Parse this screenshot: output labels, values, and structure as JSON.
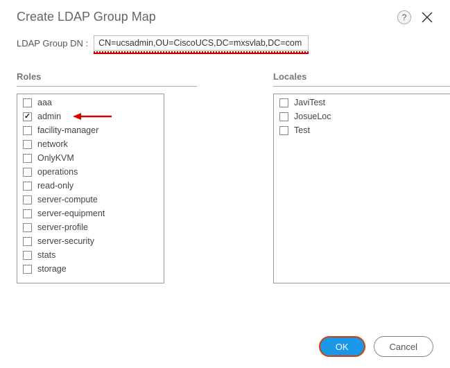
{
  "dialog": {
    "title": "Create LDAP Group Map",
    "help_tooltip": "?",
    "field_label": "LDAP Group DN :",
    "dn_value": "CN=ucsadmin,OU=CiscoUCS,DC=mxsvlab,DC=com"
  },
  "roles_panel": {
    "title": "Roles",
    "items": [
      {
        "label": "aaa",
        "checked": false
      },
      {
        "label": "admin",
        "checked": true,
        "annotated": true
      },
      {
        "label": "facility-manager",
        "checked": false
      },
      {
        "label": "network",
        "checked": false
      },
      {
        "label": "OnlyKVM",
        "checked": false
      },
      {
        "label": "operations",
        "checked": false
      },
      {
        "label": "read-only",
        "checked": false
      },
      {
        "label": "server-compute",
        "checked": false
      },
      {
        "label": "server-equipment",
        "checked": false
      },
      {
        "label": "server-profile",
        "checked": false
      },
      {
        "label": "server-security",
        "checked": false
      },
      {
        "label": "stats",
        "checked": false
      },
      {
        "label": "storage",
        "checked": false
      }
    ]
  },
  "locales_panel": {
    "title": "Locales",
    "items": [
      {
        "label": "JaviTest",
        "checked": false
      },
      {
        "label": "JosueLoc",
        "checked": false
      },
      {
        "label": "Test",
        "checked": false
      }
    ]
  },
  "footer": {
    "ok_label": "OK",
    "cancel_label": "Cancel"
  },
  "colors": {
    "primary": "#1a97e6",
    "annotation": "#d10000"
  }
}
